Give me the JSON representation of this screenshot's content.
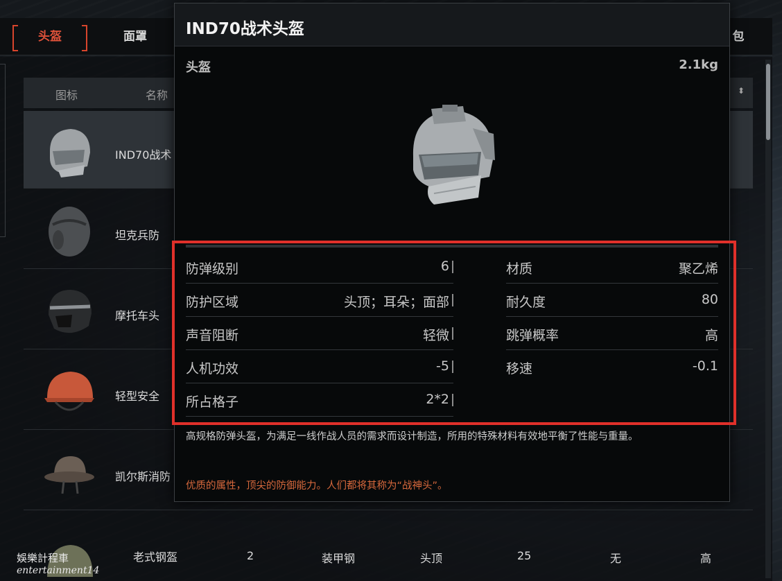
{
  "tabs": {
    "helmet": "头盔",
    "mask": "面罩",
    "bag": "包"
  },
  "list": {
    "header": {
      "icon": "图标",
      "name": "名称"
    },
    "rows": [
      {
        "name": "IND70战术"
      },
      {
        "name": "坦克兵防"
      },
      {
        "name": "摩托车头"
      },
      {
        "name": "轻型安全"
      },
      {
        "name": "凯尔斯消防"
      },
      {
        "name": "老式钢盔",
        "level": "2",
        "material": "装甲钢",
        "area": "头顶",
        "durability": "25",
        "sound": "无",
        "ricochet": "高"
      }
    ]
  },
  "tooltip": {
    "title": "IND70战术头盔",
    "category": "头盔",
    "weight": "2.1kg",
    "stats_left": [
      {
        "label": "防弹级别",
        "value": "6"
      },
      {
        "label": "防护区域",
        "value": "头顶；耳朵；面部"
      },
      {
        "label": "声音阻断",
        "value": "轻微"
      },
      {
        "label": "人机功效",
        "value": "-5"
      },
      {
        "label": "所占格子",
        "value": "2*2"
      }
    ],
    "stats_right": [
      {
        "label": "材质",
        "value": "聚乙烯"
      },
      {
        "label": "耐久度",
        "value": "80"
      },
      {
        "label": "跳弹概率",
        "value": "高"
      },
      {
        "label": "移速",
        "value": "-0.1"
      }
    ],
    "description": "高规格防弹头盔，为满足一线作战人员的需求而设计制造，所用的特殊材料有效地平衡了性能与重量。",
    "flavor": "优质的属性，顶尖的防御能力。人们都将其称为“战神头”。"
  },
  "watermark": {
    "line1": "娛樂計程車",
    "line2": "entertainment14"
  },
  "colors": {
    "accent": "#e0523a",
    "highlight": "#e0302a",
    "flavor": "#d7683c"
  }
}
